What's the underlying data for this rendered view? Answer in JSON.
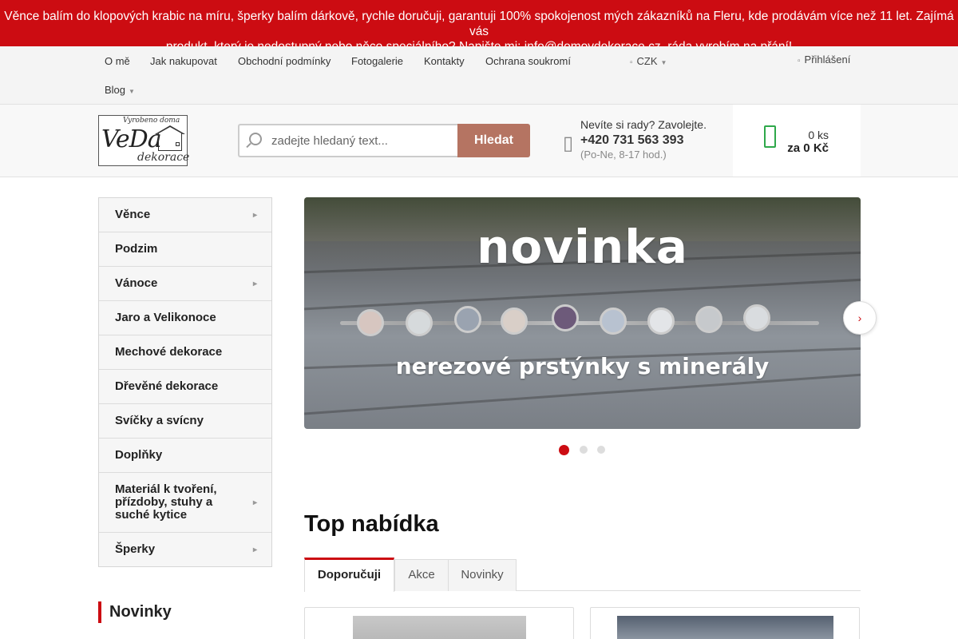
{
  "announcement": {
    "line1": "Věnce balím do klopových krabic na míru, šperky balím dárkově, rychle doručuji, garantuji 100% spokojenost mých zákazníků na Fleru, kde prodávám více než 11 let. Zajímá vás",
    "line2": "produkt, který je nedostupný nebo něco speciálního? Napište mi: info@domovdekorace.cz, ráda vyrobím na přání!"
  },
  "topnav": {
    "links": [
      "O mě",
      "Jak nakupovat",
      "Obchodní podmínky",
      "Fotogalerie",
      "Kontakty",
      "Ochrana soukromí",
      "Blog"
    ],
    "currency": "CZK",
    "login": "Přihlášení"
  },
  "header": {
    "logo": {
      "top": "Vyrobeno doma",
      "main": "VeDa",
      "bottom": "dekorace"
    },
    "search": {
      "placeholder": "zadejte hledaný text...",
      "button": "Hledat"
    },
    "contact": {
      "question": "Nevíte si rady? Zavolejte.",
      "phone": "+420 731 563 393",
      "hours": "(Po-Ne, 8-17 hod.)"
    },
    "cart": {
      "count": "0 ks",
      "total": "za 0 Kč"
    },
    "colors": {
      "accent": "#cc0c12",
      "search_button": "#b57462",
      "cart_icon": "#2ea84a"
    }
  },
  "sidebar": {
    "items": [
      {
        "label": "Věnce",
        "submenu": true
      },
      {
        "label": "Podzim",
        "submenu": false
      },
      {
        "label": "Vánoce",
        "submenu": true
      },
      {
        "label": "Jaro a Velikonoce",
        "submenu": false
      },
      {
        "label": "Mechové dekorace",
        "submenu": false
      },
      {
        "label": "Dřevěné dekorace",
        "submenu": false
      },
      {
        "label": "Svíčky a svícny",
        "submenu": false
      },
      {
        "label": "Doplňky",
        "submenu": false
      },
      {
        "label": "Materiál k tvoření, přízdoby, stuhy a suché kytice",
        "submenu": true
      },
      {
        "label": "Šperky",
        "submenu": true
      }
    ],
    "novinky_heading": "Novinky"
  },
  "banner": {
    "title": "novinka",
    "subtitle": "nerezové prstýnky s minerály",
    "slides": 3,
    "active_slide": 1
  },
  "top_offer": {
    "heading": "Top nabídka",
    "tabs": [
      "Doporučuji",
      "Akce",
      "Novinky"
    ],
    "active_tab": "Doporučuji"
  }
}
